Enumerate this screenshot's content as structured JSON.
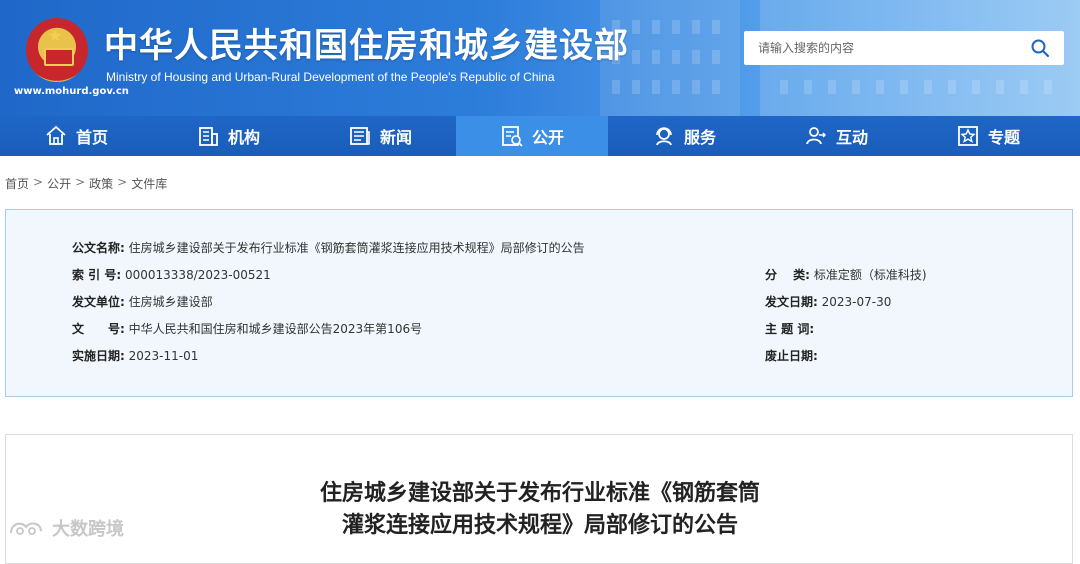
{
  "header": {
    "site_title": "中华人民共和国住房和城乡建设部",
    "site_subtitle": "Ministry of Housing and Urban-Rural Development of the People's Republic of China",
    "url": "www.mohurd.gov.cn",
    "search_placeholder": "请输入搜索的内容"
  },
  "nav": {
    "items": [
      {
        "label": "首页",
        "icon": "home-icon"
      },
      {
        "label": "机构",
        "icon": "building-icon"
      },
      {
        "label": "新闻",
        "icon": "news-icon"
      },
      {
        "label": "公开",
        "icon": "disclosure-icon",
        "active": true
      },
      {
        "label": "服务",
        "icon": "service-icon"
      },
      {
        "label": "互动",
        "icon": "interaction-icon"
      },
      {
        "label": "专题",
        "icon": "topic-star-icon"
      }
    ]
  },
  "breadcrumb": {
    "items": [
      "首页",
      "公开",
      "政策",
      "文件库"
    ],
    "separator": ">"
  },
  "info": {
    "doc_name_label": "公文名称:",
    "doc_name": "住房城乡建设部关于发布行业标准《钢筋套筒灌浆连接应用技术规程》局部修订的公告",
    "index_label": "索 引 号:",
    "index": "000013338/2023-00521",
    "category_label": "分　 类:",
    "category": "标准定额（标准科技)",
    "issuer_label": "发文单位:",
    "issuer": "住房城乡建设部",
    "issue_date_label": "发文日期:",
    "issue_date": "2023-07-30",
    "doc_no_label": "文　　号:",
    "doc_no": "中华人民共和国住房和城乡建设部公告2023年第106号",
    "keywords_label": "主 题 词:",
    "keywords": "",
    "effective_label": "实施日期:",
    "effective_date": "2023-11-01",
    "repeal_label": "废止日期:",
    "repeal_date": ""
  },
  "article": {
    "title_line1": "住房城乡建设部关于发布行业标准《钢筋套筒",
    "title_line2": "灌浆连接应用技术规程》局部修订的公告"
  },
  "watermark": {
    "text": "大数跨境"
  },
  "colors": {
    "nav_bg": "#1f66c6",
    "nav_active": "#3b8fe6",
    "info_bg": "#f1f7fd",
    "info_border": "#a9cbe8"
  }
}
